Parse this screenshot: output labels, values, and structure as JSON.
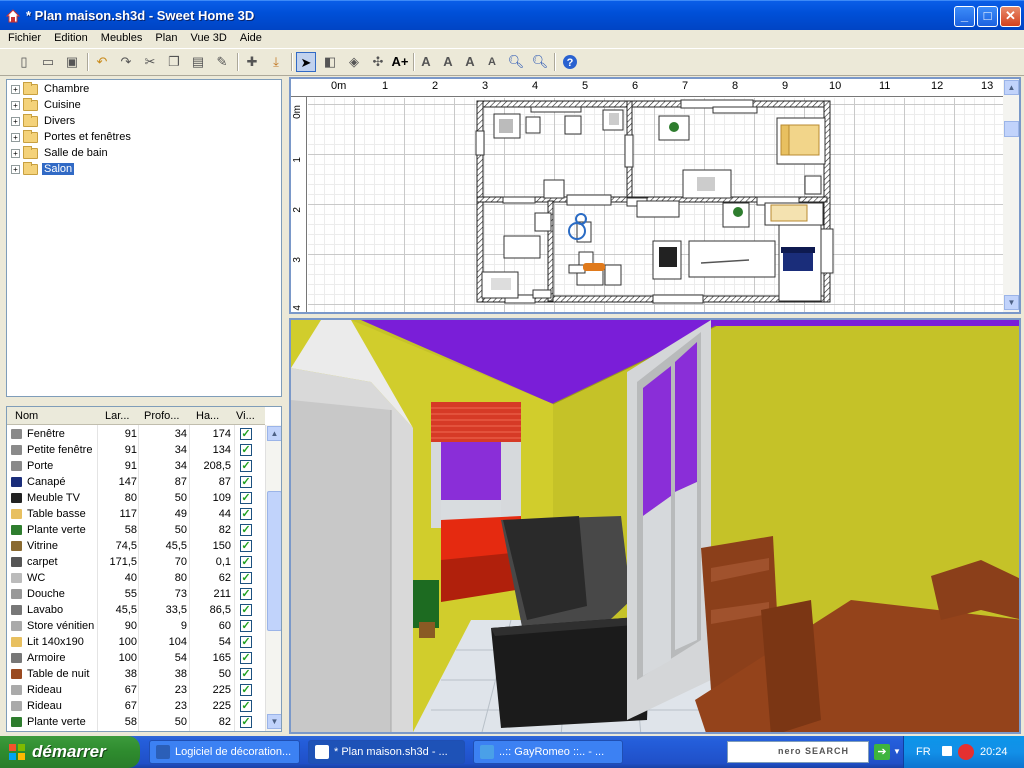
{
  "window": {
    "title": "* Plan maison.sh3d - Sweet Home 3D"
  },
  "menu": [
    "Fichier",
    "Edition",
    "Meubles",
    "Plan",
    "Vue 3D",
    "Aide"
  ],
  "catalog": {
    "categories": [
      {
        "label": "Chambre"
      },
      {
        "label": "Cuisine"
      },
      {
        "label": "Divers"
      },
      {
        "label": "Portes et fenêtres"
      },
      {
        "label": "Salle de bain"
      },
      {
        "label": "Salon",
        "selected": true
      }
    ]
  },
  "furniture": {
    "columns": [
      "Nom",
      "Lar...",
      "Profo...",
      "Ha...",
      "Vi..."
    ],
    "rows": [
      {
        "name": "Fenêtre",
        "w": "91",
        "d": "34",
        "h": "174"
      },
      {
        "name": "Petite fenêtre",
        "w": "91",
        "d": "34",
        "h": "134"
      },
      {
        "name": "Porte",
        "w": "91",
        "d": "34",
        "h": "208,5"
      },
      {
        "name": "Canapé",
        "w": "147",
        "d": "87",
        "h": "87"
      },
      {
        "name": "Meuble TV",
        "w": "80",
        "d": "50",
        "h": "109"
      },
      {
        "name": "Table basse",
        "w": "117",
        "d": "49",
        "h": "44"
      },
      {
        "name": "Plante verte",
        "w": "58",
        "d": "50",
        "h": "82"
      },
      {
        "name": "Vitrine",
        "w": "74,5",
        "d": "45,5",
        "h": "150"
      },
      {
        "name": "carpet",
        "w": "171,5",
        "d": "70",
        "h": "0,1"
      },
      {
        "name": "WC",
        "w": "40",
        "d": "80",
        "h": "62"
      },
      {
        "name": "Douche",
        "w": "55",
        "d": "73",
        "h": "211"
      },
      {
        "name": "Lavabo",
        "w": "45,5",
        "d": "33,5",
        "h": "86,5"
      },
      {
        "name": "Store vénitien",
        "w": "90",
        "d": "9",
        "h": "60"
      },
      {
        "name": "Lit 140x190",
        "w": "100",
        "d": "104",
        "h": "54"
      },
      {
        "name": "Armoire",
        "w": "100",
        "d": "54",
        "h": "165"
      },
      {
        "name": "Table de nuit",
        "w": "38",
        "d": "38",
        "h": "50"
      },
      {
        "name": "Rideau",
        "w": "67",
        "d": "23",
        "h": "225"
      },
      {
        "name": "Rideau",
        "w": "67",
        "d": "23",
        "h": "225"
      },
      {
        "name": "Plante verte",
        "w": "58",
        "d": "50",
        "h": "82"
      }
    ]
  },
  "plan": {
    "ruler_x": [
      "0m",
      "1",
      "2",
      "3",
      "4",
      "5",
      "6",
      "7",
      "8",
      "9",
      "10",
      "11",
      "12",
      "13"
    ],
    "ruler_y": [
      "0m",
      "1",
      "2",
      "3",
      "4"
    ]
  },
  "taskbar": {
    "start": "démarrer",
    "tasks": [
      "Logiciel de décoration...",
      "* Plan maison.sh3d - ...",
      "..:: GayRomeo ::.. - ..."
    ],
    "search_brand": "nero SEARCH",
    "lang": "FR",
    "clock": "20:24"
  },
  "colors": {
    "titlebar": "#0050d8",
    "wall3d": "#c8c42a",
    "ceiling3d": "#7b1fd9",
    "sofa": "#e82810",
    "selection": "#316ac5"
  }
}
